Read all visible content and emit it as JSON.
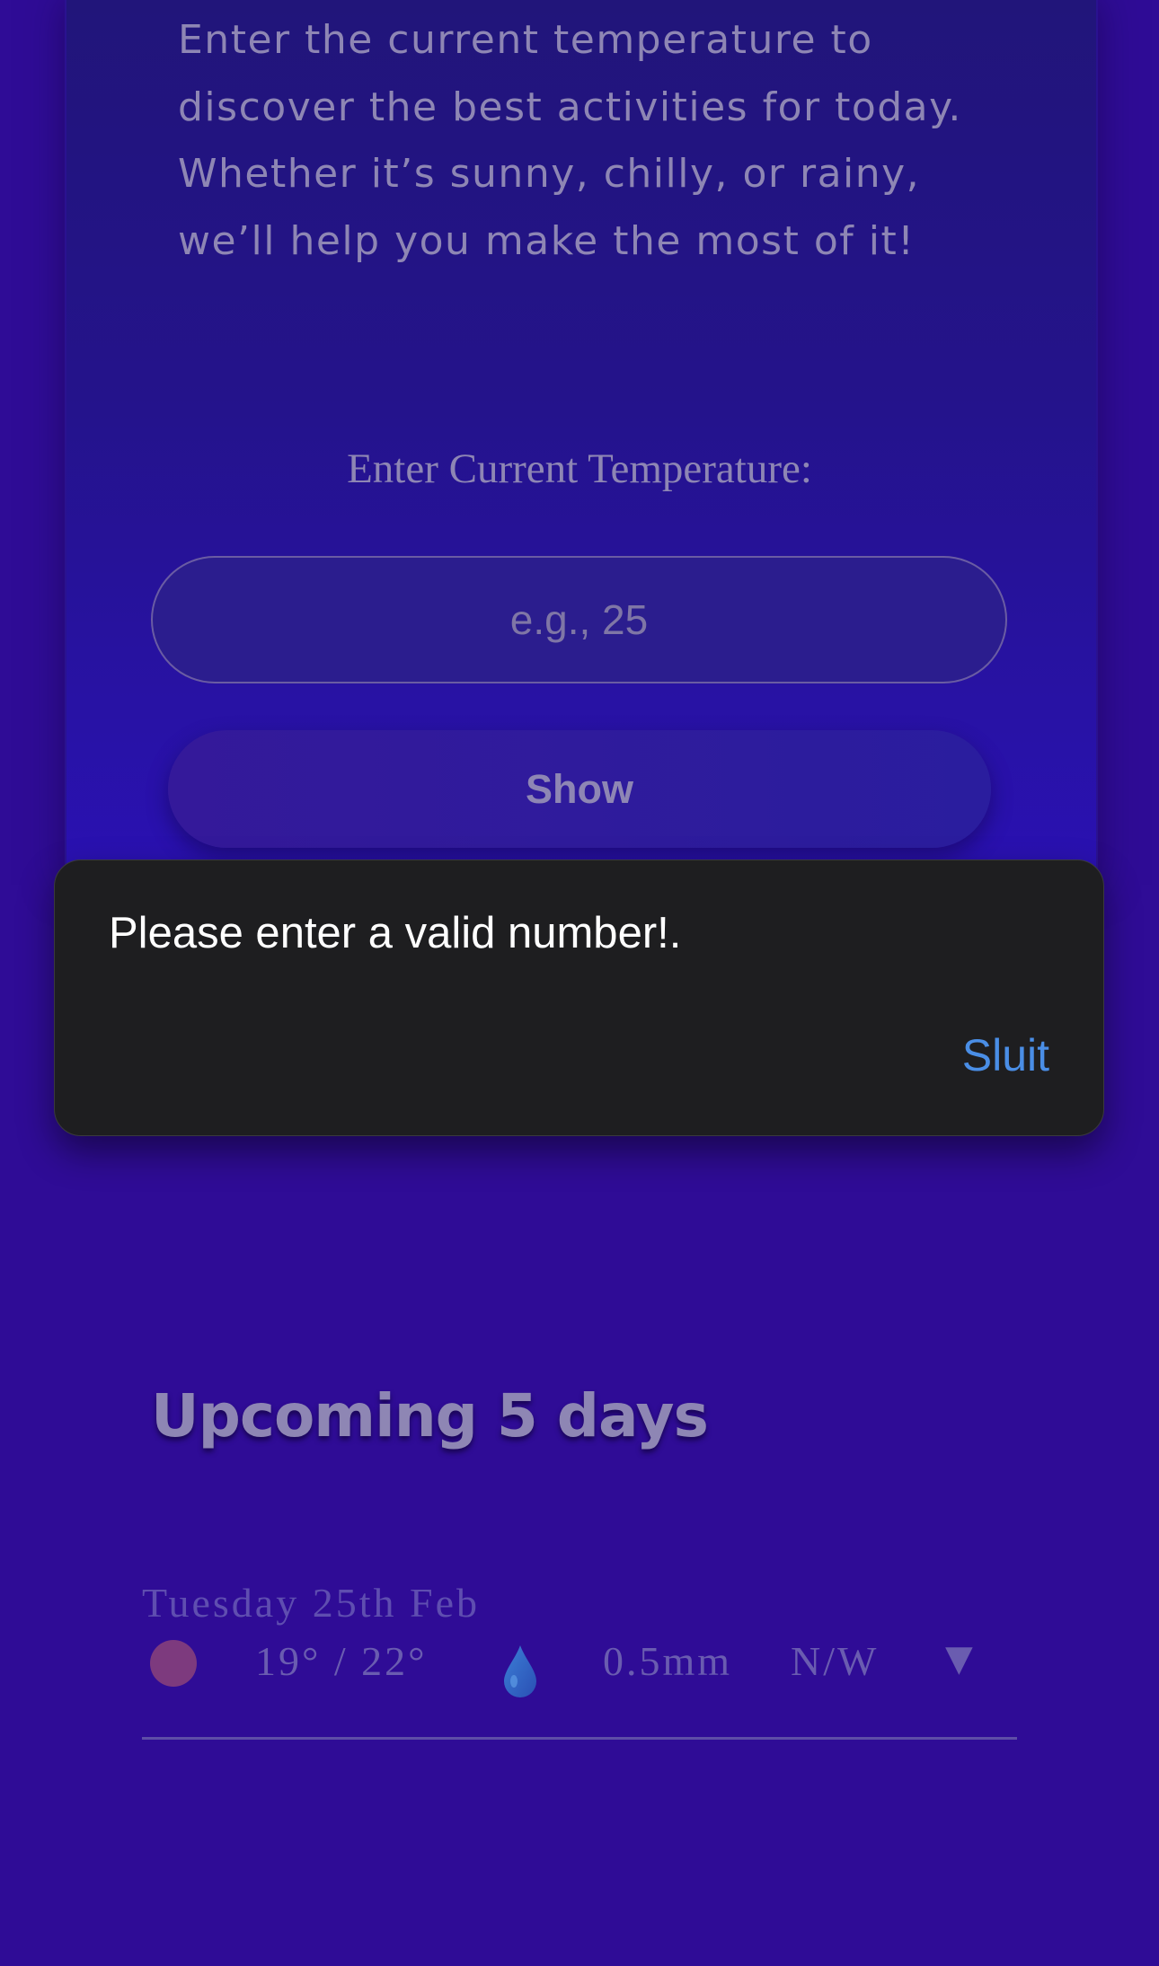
{
  "intro": {
    "line1": "Enter the current temperature to",
    "line2": "discover the best activities for today.",
    "line3": "Whether it’s sunny, chilly, or rainy,",
    "line4": "we’ll help you make the most of it!"
  },
  "temperature_form": {
    "label": "Enter Current Temperature:",
    "input_value": "",
    "input_placeholder": "e.g., 25",
    "show_button_label": "Show"
  },
  "alert": {
    "message": "Please enter a valid number!.",
    "close_label": "Sluit",
    "close_color": "#4a8ee6"
  },
  "forecast": {
    "title": "Upcoming 5 days",
    "days": [
      {
        "date": "Tuesday 25th Feb",
        "weather_icon": "sun-icon",
        "temps": "19° / 22°",
        "rain_icon": "water-drop-icon",
        "rain": "0.5mm",
        "wind": "N/W",
        "toggle": "▼"
      }
    ]
  },
  "colors": {
    "background": "#2f0c96",
    "muted_text": "#8e86b4",
    "dialog_background": "#1e1e20",
    "accent_link": "#4a8ee6"
  }
}
